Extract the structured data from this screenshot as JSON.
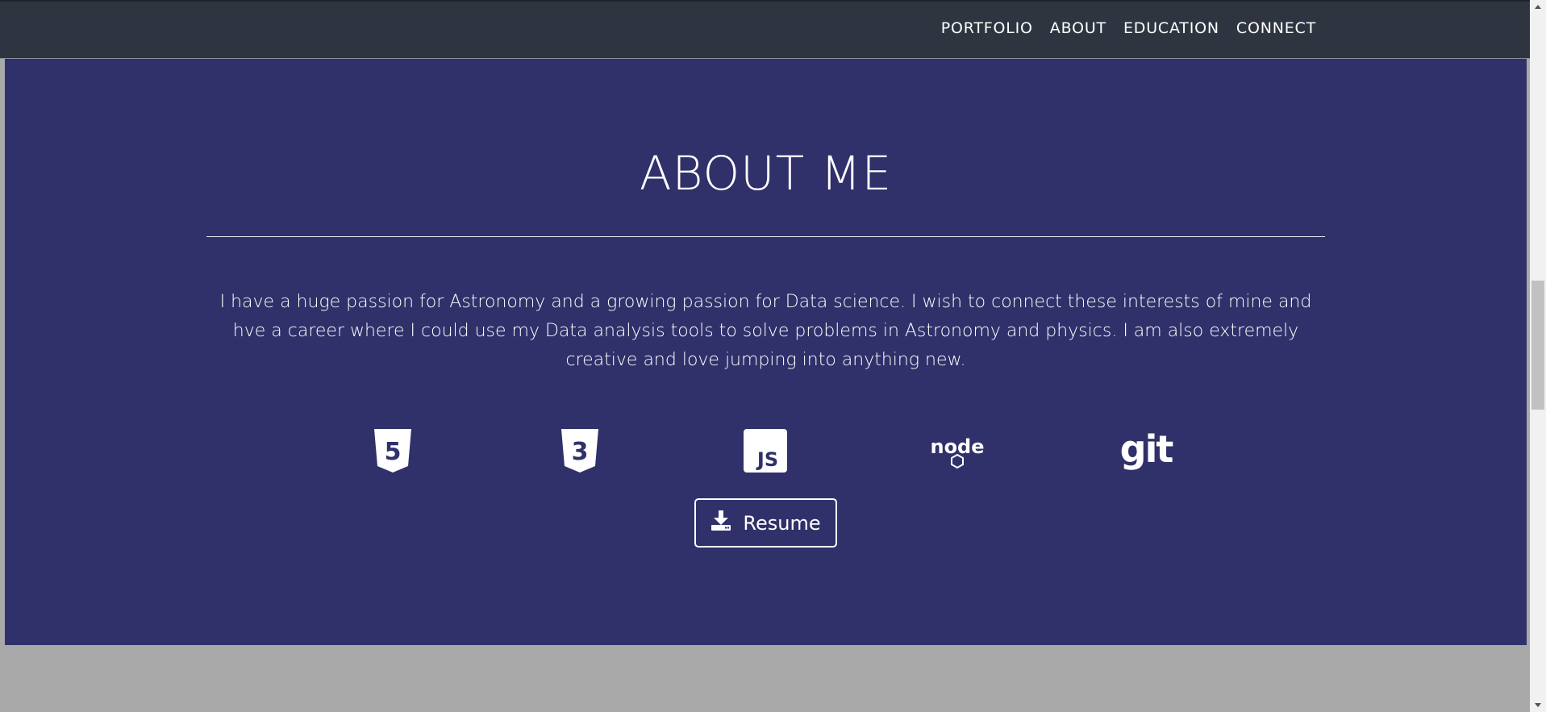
{
  "nav": {
    "links": [
      "PORTFOLIO",
      "ABOUT",
      "EDUCATION",
      "CONNECT"
    ]
  },
  "about": {
    "title": "ABOUT ME",
    "description": "I have a huge passion for Astronomy and a growing passion for Data science. I wish to connect these interests of mine and hve a career where I could use my Data analysis tools to solve problems in Astronomy and physics. I am also extremely creative and love jumping into anything new.",
    "skills": [
      {
        "icon": "html5-icon",
        "label": "5"
      },
      {
        "icon": "css3-icon",
        "label": "3"
      },
      {
        "icon": "javascript-icon",
        "label": "JS"
      },
      {
        "icon": "nodejs-icon",
        "label": "node"
      },
      {
        "icon": "git-icon",
        "label": "git"
      }
    ],
    "resume_label": "Resume"
  },
  "colors": {
    "nav_bg": "#2f3540",
    "section_bg": "#30306a",
    "page_bg": "#a9a9a9",
    "text": "#ffffff"
  }
}
